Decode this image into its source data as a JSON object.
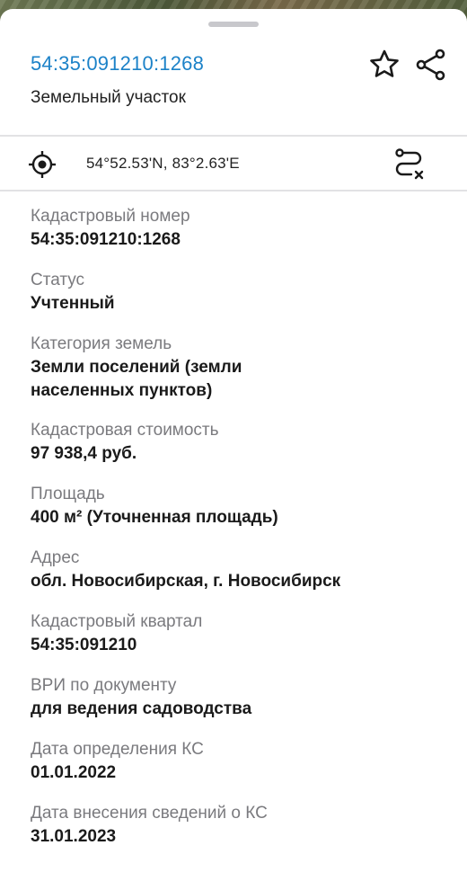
{
  "header": {
    "title": "54:35:091210:1268",
    "subtitle": "Земельный участок"
  },
  "location": {
    "coordinates": "54°52.53'N, 83°2.63'E"
  },
  "fields": [
    {
      "label": "Кадастровый номер",
      "value": "54:35:091210:1268"
    },
    {
      "label": "Статус",
      "value": "Учтенный"
    },
    {
      "label": "Категория земель",
      "value": "Земли поселений (земли",
      "value2": "населенных пунктов)"
    },
    {
      "label": "Кадастровая стоимость",
      "value": "97 938,4 руб."
    },
    {
      "label": "Площадь",
      "value": "400 м² (Уточненная площадь)"
    },
    {
      "label": "Адрес",
      "value": "обл. Новосибирская, г. Новосибирск"
    },
    {
      "label": "Кадастровый квартал",
      "value": "54:35:091210"
    },
    {
      "label": "ВРИ по документу",
      "value": "для ведения садоводства"
    },
    {
      "label": "Дата определения КС",
      "value": "01.01.2022"
    },
    {
      "label": "Дата внесения сведений о КС",
      "value": "31.01.2023"
    }
  ],
  "colors": {
    "accent": "#1c82c8",
    "label": "#7a7a7e",
    "value": "#1a1a1a"
  }
}
